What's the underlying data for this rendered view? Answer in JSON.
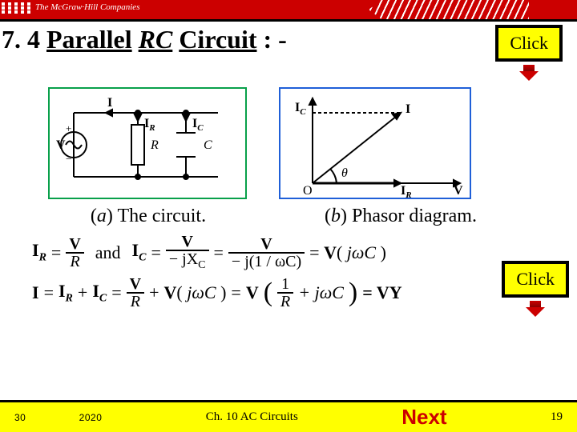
{
  "brand": "The McGraw·Hill Companies",
  "title": {
    "num": "7. 4 ",
    "word1": "Parallel",
    "rc": "RC",
    "word2": "Circuit",
    "tail": " : -"
  },
  "click_label": "Click",
  "captions": {
    "a_it": "a",
    "a_txt": ") The circuit.",
    "b_it": "b",
    "b_txt": ") Phasor diagram."
  },
  "fig_a": {
    "V": "V",
    "I": "I",
    "IR": "I",
    "IRsub": "R",
    "IC": "I",
    "ICsub": "C",
    "R": "R",
    "C": "C",
    "plus": "+",
    "minus": "−"
  },
  "fig_b": {
    "IC": "I",
    "ICsub": "C",
    "I": "I",
    "IR": "I",
    "IRsub": "R",
    "V": "V",
    "O": "O",
    "theta": "θ"
  },
  "eq1": {
    "IR": "I",
    "IRsub": "R",
    "eq": " = ",
    "V": "V",
    "R": "R",
    "and": "and",
    "IC": "I",
    "ICsub": "C",
    "mjXC": "− jX",
    "XCsub": "C",
    "mj1wC": "− j(1 / ωC)",
    "rhs": " = V( jωC )"
  },
  "eq2": {
    "I": "I",
    "eq": " = ",
    "plus": " + ",
    "IR": "I",
    "IRsub": "R",
    "IC": "I",
    "ICsub": "C",
    "V": "V",
    "R": "R",
    "VjwC": "V( jωC )",
    "inner": " + jωC ",
    "one": "1",
    "VY": " = VY"
  },
  "footer": {
    "left": "30      2020",
    "mid": "Ch. 10 AC Circuits",
    "next": "Next",
    "page": "19"
  }
}
